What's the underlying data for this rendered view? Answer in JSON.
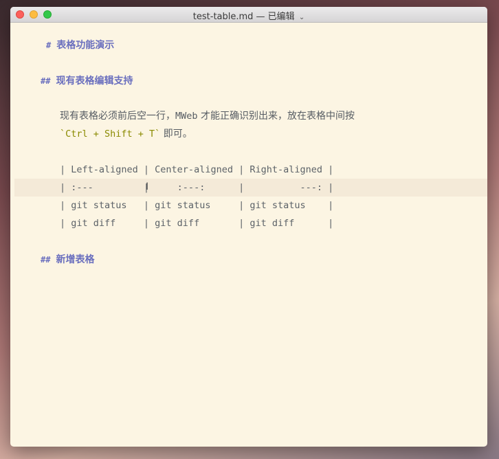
{
  "window": {
    "title": "test-table.md — 已编辑",
    "title_chevron": "⌄",
    "background_color": "#fcf5e3",
    "heading_color": "#6a6fbe",
    "code_color": "#8a8a00"
  },
  "editor": {
    "h1": {
      "marker": "#",
      "text": "表格功能演示"
    },
    "h2_existing": {
      "marker": "##",
      "text": "现有表格编辑支持"
    },
    "paragraph": {
      "line1_a": "现有表格必须前后空一行，",
      "line1_mweb": "MWeb",
      "line1_b": " 才能正确识别出来，放在表格中间按",
      "line2_code": "`Ctrl + Shift + T`",
      "line2_b": " 即可。"
    },
    "table_lines": [
      "| Left-aligned | Center-aligned | Right-aligned |",
      "| :---         |     :---:      |          ---: |",
      "| git status   | git status     | git status    |",
      "| git diff     | git diff       | git diff      |"
    ],
    "h2_new": {
      "marker": "##",
      "text": "新增表格"
    },
    "cursor_glyph": "I"
  }
}
